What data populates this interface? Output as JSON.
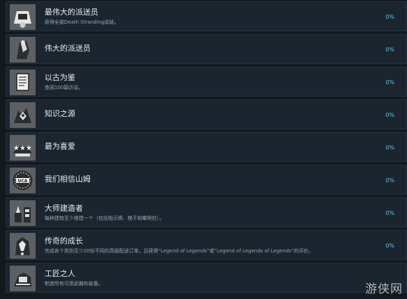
{
  "achievements": [
    {
      "title": "最伟大的派送员",
      "desc": "获得全部Death Stranding成就。",
      "percent": "0%",
      "icon": "delivery-emblem-icon"
    },
    {
      "title": "伟大的派送员",
      "desc": "",
      "percent": "0%",
      "icon": "porter-icon"
    },
    {
      "title": "以古为鉴",
      "desc": "查阅100篇访谈。",
      "percent": "0%",
      "icon": "document-icon"
    },
    {
      "title": "知识之源",
      "desc": "",
      "percent": "0%",
      "icon": "bird-icon"
    },
    {
      "title": "最为喜爱",
      "desc": "",
      "percent": "0%",
      "icon": "stars-icon"
    },
    {
      "title": "我们相信山姆",
      "desc": "",
      "percent": "0%",
      "icon": "uca-emblem-icon"
    },
    {
      "title": "大师建造者",
      "desc": "每种建筑至少搭建一个（包括指示牌、梯子和攀爬柱）。",
      "percent": "0%",
      "icon": "builder-icon"
    },
    {
      "title": "传奇的成长",
      "desc": "完成各个类别至少20份不同的高级配送订单，且获得“Legend of Legends”或“Legend of Legends of Legends”的评价。",
      "percent": "0%",
      "icon": "legend-icon"
    },
    {
      "title": "工匠之人",
      "desc": "制造所有可用武器和装备。",
      "percent": "",
      "icon": "craftsman-icon"
    }
  ],
  "watermark": "游侠网",
  "colors": {
    "background": "#14191f",
    "row": "#1b2530",
    "percent": "#66c0f4"
  }
}
